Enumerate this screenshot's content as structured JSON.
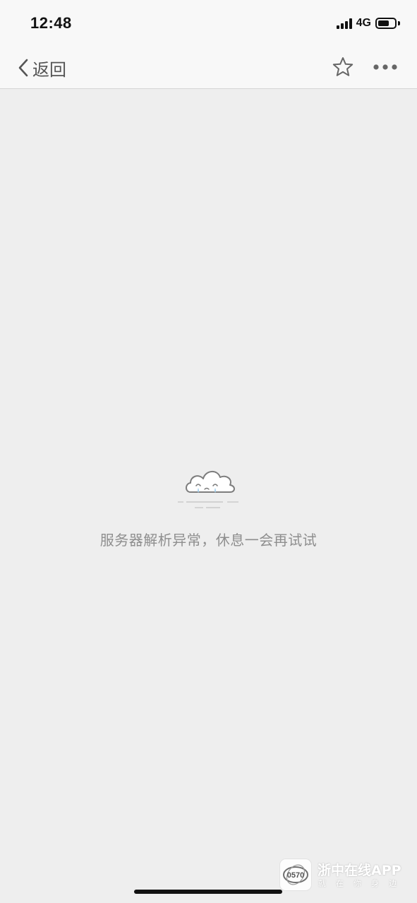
{
  "status_bar": {
    "time": "12:48",
    "network": "4G",
    "battery_level": 0.7
  },
  "nav": {
    "back_label": "返回",
    "back_icon": "chevron-left-icon",
    "favorite_icon": "star-outline-icon",
    "more_icon": "more-dots-icon"
  },
  "error": {
    "icon": "crying-cloud-icon",
    "message": "服务器解析异常，休息一会再试试"
  },
  "watermark": {
    "logo_text": "0570",
    "title": "浙中在线APP",
    "subtitle": "就在你身边"
  },
  "colors": {
    "background": "#eeeeee",
    "nav_background": "#f8f8f8",
    "message_text": "#8e8e8e",
    "tear_blue": "#a9d4ef"
  }
}
